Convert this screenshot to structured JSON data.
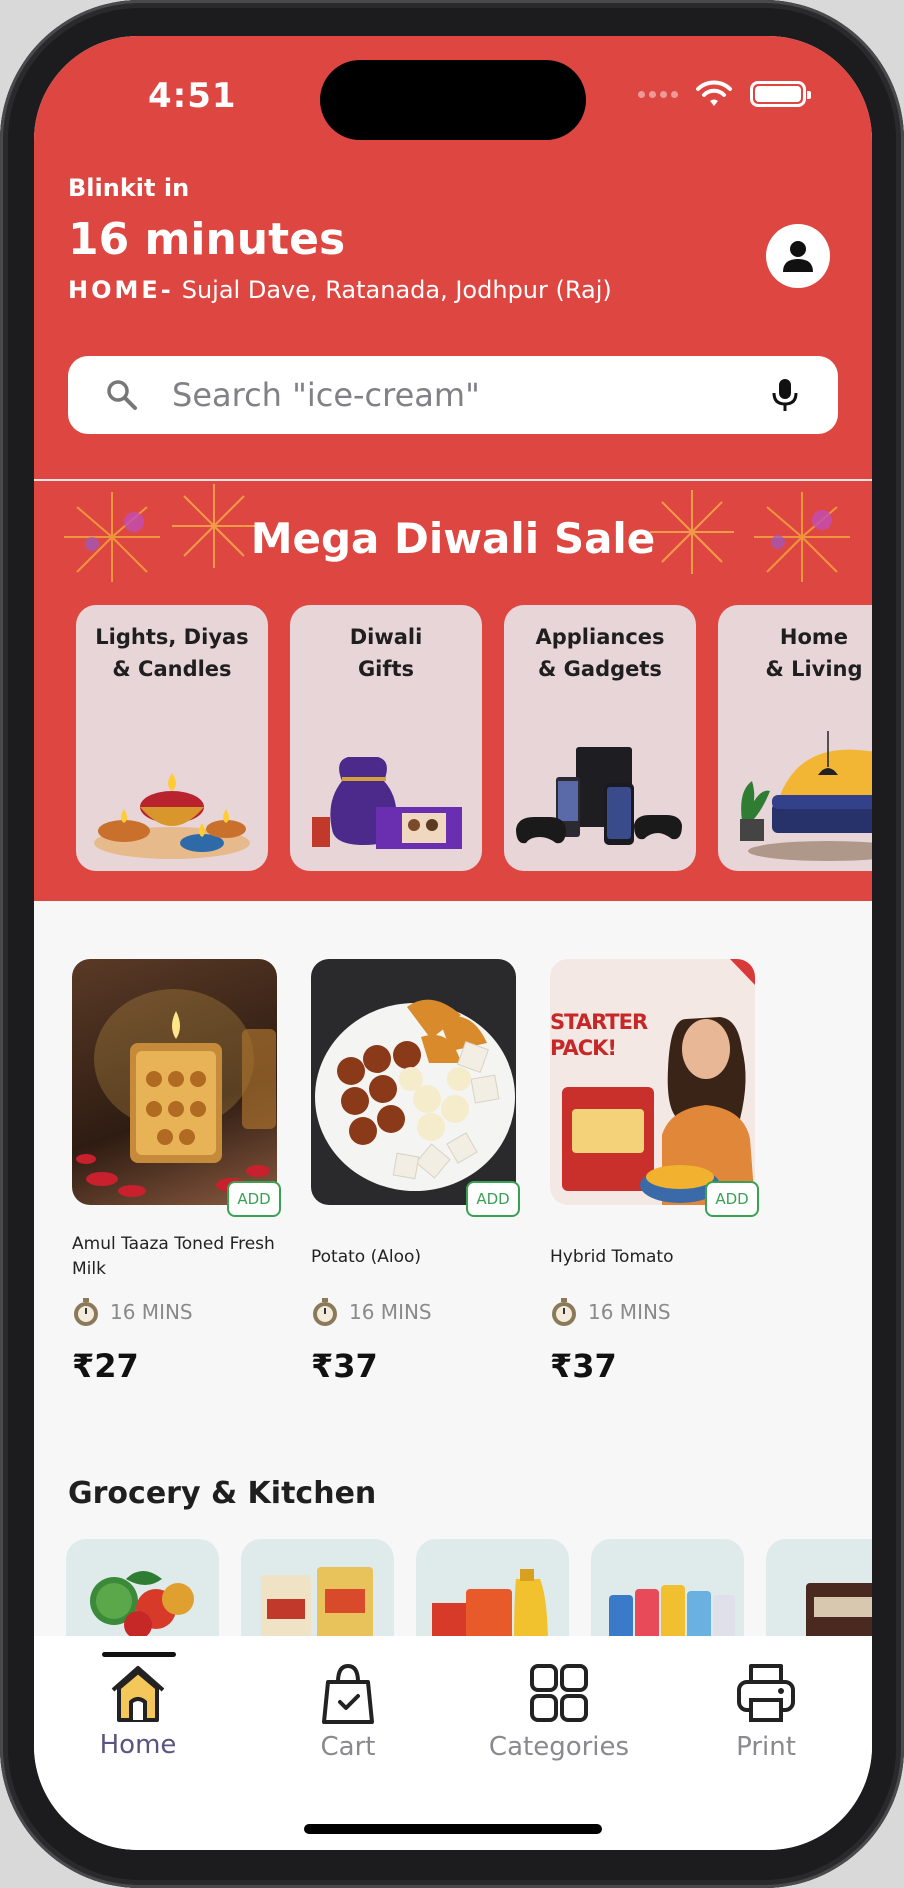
{
  "status_bar": {
    "time": "4:51"
  },
  "header": {
    "brand_line": "Blinkit in",
    "delivery_time": "16 minutes",
    "address_label": "HOME-",
    "address": "Sujal Dave, Ratanada, Jodhpur (Raj)"
  },
  "search": {
    "placeholder": "Search \"ice-cream\""
  },
  "banner": {
    "title": "Mega Diwali Sale",
    "categories": [
      {
        "label": "Lights, Diyas\n& Candles"
      },
      {
        "label": "Diwali\nGifts"
      },
      {
        "label": "Appliances\n& Gadgets"
      },
      {
        "label": "Home\n& Living"
      }
    ]
  },
  "products": [
    {
      "name": "Amul Taaza Toned Fresh Milk",
      "eta": "16 MINS",
      "price": "₹27",
      "add_label": "ADD"
    },
    {
      "name": "Potato (Aloo)",
      "eta": "16 MINS",
      "price": "₹37",
      "add_label": "ADD"
    },
    {
      "name": "Hybrid Tomato",
      "eta": "16 MINS",
      "price": "₹37",
      "add_label": "ADD",
      "image_text": "STARTER PACK!"
    }
  ],
  "section": {
    "title": "Grocery & Kitchen"
  },
  "tabs": [
    {
      "label": "Home",
      "icon": "home-icon",
      "active": true
    },
    {
      "label": "Cart",
      "icon": "shopping-bag-icon",
      "active": false
    },
    {
      "label": "Categories",
      "icon": "grid-icon",
      "active": false
    },
    {
      "label": "Print",
      "icon": "printer-icon",
      "active": false
    }
  ],
  "colors": {
    "brand_red": "#de4741",
    "add_green": "#3aa154",
    "active_tab": "#5b5480"
  }
}
